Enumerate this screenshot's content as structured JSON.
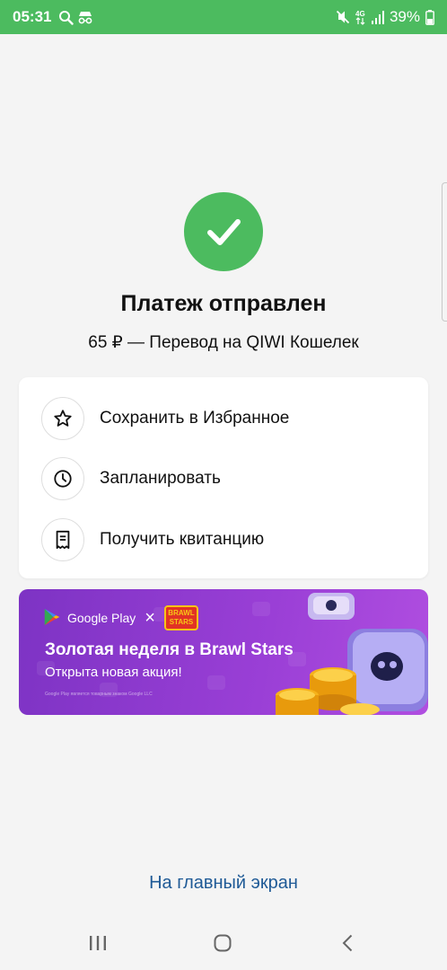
{
  "status_bar": {
    "time": "05:31",
    "battery_percent": "39%",
    "icons": [
      "search-icon",
      "incognito-icon",
      "mute-icon",
      "4g-icon",
      "signal-icon",
      "battery-icon"
    ]
  },
  "result": {
    "title": "Платеж отправлен",
    "subtitle": "65 ₽ — Перевод на QIWI Кошелек",
    "status_icon": "check-icon"
  },
  "actions": [
    {
      "label": "Сохранить в Избранное",
      "icon": "star-icon"
    },
    {
      "label": "Запланировать",
      "icon": "clock-icon"
    },
    {
      "label": "Получить квитанцию",
      "icon": "receipt-icon"
    }
  ],
  "promo": {
    "partner": "Google Play",
    "separator": "×",
    "brand_logo_line1": "BRAWL",
    "brand_logo_line2": "STARS",
    "title": "Золотая неделя в Brawl Stars",
    "subtitle": "Открыта новая акция!",
    "fine_print": "Google Play является товарным знаком Google LLC"
  },
  "footer": {
    "home_link": "На главный экран"
  },
  "nav_bar": {
    "buttons": [
      "recent-apps-icon",
      "home-icon",
      "back-icon"
    ]
  },
  "colors": {
    "accent_green": "#4cbb5f",
    "link_blue": "#1f5a96",
    "promo_purple": "#8a37cc"
  }
}
